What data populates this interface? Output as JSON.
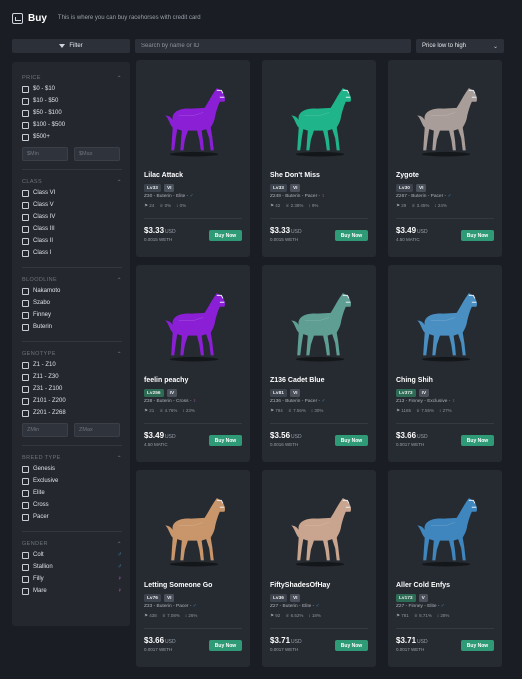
{
  "header": {
    "title": "Buy",
    "subtitle": "This is where you can buy racehorses with credit card"
  },
  "toolbar": {
    "filter_label": "Filter",
    "search_placeholder": "Search by name or ID",
    "sort_value": "Price low to high"
  },
  "sidebar": {
    "price": {
      "title": "PRICE",
      "options": [
        "$0 - $10",
        "$10 - $50",
        "$50 - $100",
        "$100 - $500",
        "$500+"
      ],
      "min_placeholder": "$Min",
      "max_placeholder": "$Max"
    },
    "class": {
      "title": "CLASS",
      "options": [
        "Class VI",
        "Class V",
        "Class IV",
        "Class III",
        "Class II",
        "Class I"
      ]
    },
    "bloodline": {
      "title": "BLOODLINE",
      "options": [
        "Nakamoto",
        "Szabo",
        "Finney",
        "Buterin"
      ]
    },
    "genotype": {
      "title": "GENOTYPE",
      "options": [
        "Z1 - Z10",
        "Z11 - Z30",
        "Z31 - Z100",
        "Z101 - Z200",
        "Z201 - Z268"
      ],
      "min_placeholder": "ZMin",
      "max_placeholder": "ZMax"
    },
    "breed_type": {
      "title": "BREED TYPE",
      "options": [
        "Genesis",
        "Exclusive",
        "Elite",
        "Cross",
        "Pacer"
      ]
    },
    "gender": {
      "title": "GENDER",
      "options": [
        {
          "label": "Colt",
          "symbol": "♂"
        },
        {
          "label": "Stallion",
          "symbol": "♂"
        },
        {
          "label": "Filly",
          "symbol": "♀"
        },
        {
          "label": "Mare",
          "symbol": "♀"
        }
      ]
    }
  },
  "cards": [
    {
      "name": "Lilac Attack",
      "level": "Lv33",
      "cls": "VI",
      "info": "Z30 - Buterin - Elite -",
      "gender": "♂",
      "races": "24",
      "win": "0%",
      "place": "0%",
      "price": "$3.33",
      "currency": "USD",
      "sub": "0.0015 WETH",
      "buy": "Buy Now",
      "color": "#8a1fd6"
    },
    {
      "name": "She Don't Miss",
      "level": "Lv33",
      "cls": "VI",
      "info": "Z249 - Buterin - Pacer -",
      "gender": "♀",
      "races": "42",
      "win": "2.38%",
      "place": "9%",
      "price": "$3.33",
      "currency": "USD",
      "sub": "0.0015 WETH",
      "buy": "Buy Now",
      "color": "#1fb48a"
    },
    {
      "name": "Zygote",
      "level": "Lv30",
      "cls": "VI",
      "info": "Z267 - Buterin - Pacer -",
      "gender": "♂",
      "races": "29",
      "win": "3.45%",
      "place": "24%",
      "price": "$3.49",
      "currency": "USD",
      "sub": "4.50 MATIC",
      "buy": "Buy Now",
      "color": "#a89d99"
    },
    {
      "name": "feelin peachy",
      "level": "Lv256",
      "cls": "IV",
      "info": "Z38 - Buterin - Cross -",
      "gender": "♀",
      "races": "21",
      "win": "4.76%",
      "place": "23%",
      "price": "$3.49",
      "currency": "USD",
      "sub": "4.50 MATIC",
      "buy": "Buy Now",
      "color": "#8a1fd6"
    },
    {
      "name": "Z136 Cadet Blue",
      "level": "Lv81",
      "cls": "VI",
      "info": "Z136 - Buterin - Pacer -",
      "gender": "♂",
      "races": "794",
      "win": "7.56%",
      "place": "30%",
      "price": "$3.56",
      "currency": "USD",
      "sub": "0.0016 WETH",
      "buy": "Buy Now",
      "color": "#5f9e93"
    },
    {
      "name": "Ching Shih",
      "level": "Lv373",
      "cls": "IV",
      "info": "Z13 - Finney - Exclusive -",
      "gender": "♀",
      "races": "1165",
      "win": "7.55%",
      "place": "27%",
      "price": "$3.66",
      "currency": "USD",
      "sub": "0.0017 WETH",
      "buy": "Buy Now",
      "color": "#4a8fc2"
    },
    {
      "name": "Letting Someone Go",
      "level": "Lv76",
      "cls": "VI",
      "info": "Z33 - Buterin - Pacer -",
      "gender": "♂",
      "races": "438",
      "win": "7.08%",
      "place": "26%",
      "price": "$3.66",
      "currency": "USD",
      "sub": "0.0017 WETH",
      "buy": "Buy Now",
      "color": "#c8966a"
    },
    {
      "name": "FiftyShadesOfHay",
      "level": "Lv36",
      "cls": "VI",
      "info": "Z27 - Buterin - Elite -",
      "gender": "♂",
      "races": "92",
      "win": "6.52%",
      "place": "18%",
      "price": "$3.71",
      "currency": "USD",
      "sub": "0.0017 WETH",
      "buy": "Buy Now",
      "color": "#c9a58f"
    },
    {
      "name": "Aller Cold Enfys",
      "level": "Lv173",
      "cls": "V",
      "info": "Z27 - Finney - Elite -",
      "gender": "♂",
      "races": "781",
      "win": "8.71%",
      "place": "28%",
      "price": "$3.71",
      "currency": "USD",
      "sub": "0.0017 WETH",
      "buy": "Buy Now",
      "color": "#3f86be"
    }
  ]
}
